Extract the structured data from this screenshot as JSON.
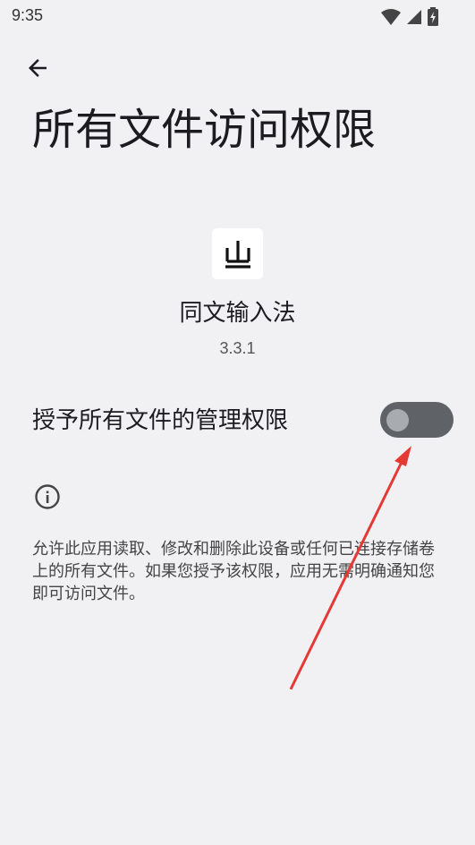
{
  "status_bar": {
    "time": "9:35",
    "icons": [
      "wifi-icon",
      "cell-signal-icon",
      "battery-charging-icon"
    ]
  },
  "header": {
    "back_icon": "arrow-back-icon",
    "title": "所有文件访问权限"
  },
  "app": {
    "icon_glyph": "ㄓ",
    "name": "同文输入法",
    "version": "3.3.1"
  },
  "permission": {
    "label": "授予所有文件的管理权限",
    "enabled": false
  },
  "info": {
    "icon": "info-icon",
    "description": "允许此应用读取、修改和删除此设备或任何已连接存储卷上的所有文件。如果您授予该权限，应用无需明确通知您即可访问文件。"
  },
  "colors": {
    "background": "#f1f1f3",
    "toggle_track": "#5f6368",
    "toggle_thumb": "#a8acb0",
    "annotation_arrow": "#e53935"
  }
}
